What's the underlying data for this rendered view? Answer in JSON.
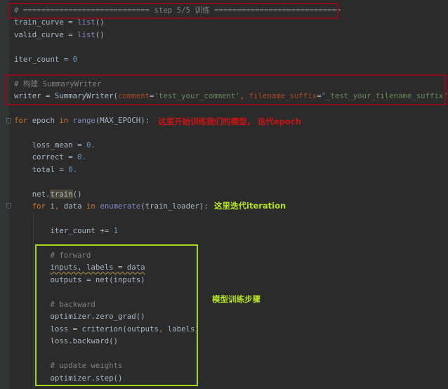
{
  "colors": {
    "red_box": "#8b0d1a",
    "green_box": "#a8d51f",
    "red_note": "#c81414",
    "green_note": "#b5e61d"
  },
  "code_lines": [
    {
      "n": 0,
      "tokens": [
        [
          "# ============================ step 5/5 训练 ============================",
          "cm"
        ]
      ]
    },
    {
      "n": 1,
      "tokens": [
        [
          "train_curve = ",
          ""
        ],
        [
          "list",
          "bi"
        ],
        [
          "()",
          ""
        ]
      ]
    },
    {
      "n": 2,
      "tokens": [
        [
          "valid_curve = ",
          ""
        ],
        [
          "list",
          "bi"
        ],
        [
          "()",
          ""
        ]
      ]
    },
    {
      "n": 4,
      "tokens": [
        [
          "iter_count = ",
          ""
        ],
        [
          "0",
          "num"
        ]
      ]
    },
    {
      "n": 6,
      "tokens": [
        [
          "# 构建 SummaryWriter",
          "cm"
        ]
      ]
    },
    {
      "n": 7,
      "tokens": [
        [
          "writer = SummaryWriter(",
          ""
        ],
        [
          "comment",
          "kwarg"
        ],
        [
          "=",
          ""
        ],
        [
          "'test_your_comment'",
          "str"
        ],
        [
          ", ",
          "kw"
        ],
        [
          "filename_suffix",
          "kwarg"
        ],
        [
          "=",
          ""
        ],
        [
          "\"_test_your_filename_suffix\"",
          "str"
        ],
        [
          ")",
          ""
        ]
      ]
    },
    {
      "n": 9,
      "tokens": [
        [
          "for ",
          "kw"
        ],
        [
          "epoch ",
          ""
        ],
        [
          "in ",
          "kw"
        ],
        [
          "range",
          "bi"
        ],
        [
          "(MAX_EPOCH):",
          ""
        ]
      ]
    },
    {
      "n": 11,
      "tokens": [
        [
          "    loss_mean = ",
          ""
        ],
        [
          "0.",
          "num"
        ]
      ]
    },
    {
      "n": 12,
      "tokens": [
        [
          "    correct = ",
          ""
        ],
        [
          "0.",
          "num"
        ]
      ]
    },
    {
      "n": 13,
      "tokens": [
        [
          "    total = ",
          ""
        ],
        [
          "0.",
          "num"
        ]
      ]
    },
    {
      "n": 15,
      "tokens": [
        [
          "    net.",
          ""
        ],
        [
          "train",
          "hl"
        ],
        [
          "()",
          ""
        ]
      ]
    },
    {
      "n": 16,
      "tokens": [
        [
          "    ",
          ""
        ],
        [
          "for ",
          "kw"
        ],
        [
          "i",
          ""
        ],
        [
          ", ",
          "kw"
        ],
        [
          "data ",
          ""
        ],
        [
          "in ",
          "kw"
        ],
        [
          "enumerate",
          "bi"
        ],
        [
          "(train_loader):",
          ""
        ]
      ]
    },
    {
      "n": 18,
      "tokens": [
        [
          "        iter_count += ",
          ""
        ],
        [
          "1",
          "num"
        ]
      ]
    },
    {
      "n": 20,
      "tokens": [
        [
          "        ",
          ""
        ],
        [
          "# forward",
          "cm"
        ]
      ]
    },
    {
      "n": 21,
      "tokens": [
        [
          "        ",
          ""
        ],
        [
          "inputs, labels = data",
          "warn"
        ]
      ]
    },
    {
      "n": 22,
      "tokens": [
        [
          "        outputs = net(inputs)",
          ""
        ]
      ]
    },
    {
      "n": 24,
      "tokens": [
        [
          "        ",
          ""
        ],
        [
          "# backward",
          "cm"
        ]
      ]
    },
    {
      "n": 25,
      "tokens": [
        [
          "        optimizer.zero_grad()",
          ""
        ]
      ]
    },
    {
      "n": 26,
      "tokens": [
        [
          "        loss = criterion(outputs",
          ""
        ],
        [
          ", ",
          "kw"
        ],
        [
          "labels)",
          ""
        ]
      ]
    },
    {
      "n": 27,
      "tokens": [
        [
          "        loss.backward()",
          ""
        ]
      ]
    },
    {
      "n": 29,
      "tokens": [
        [
          "        ",
          ""
        ],
        [
          "# update weights",
          "cm"
        ]
      ]
    },
    {
      "n": 30,
      "tokens": [
        [
          "        optimizer.step()",
          ""
        ]
      ]
    }
  ],
  "annotations": {
    "epoch_note": "这里开始训练我们的模型， 迭代epoch",
    "iteration_note": "这里迭代iteration",
    "steps_note": "模型训练步骤"
  }
}
